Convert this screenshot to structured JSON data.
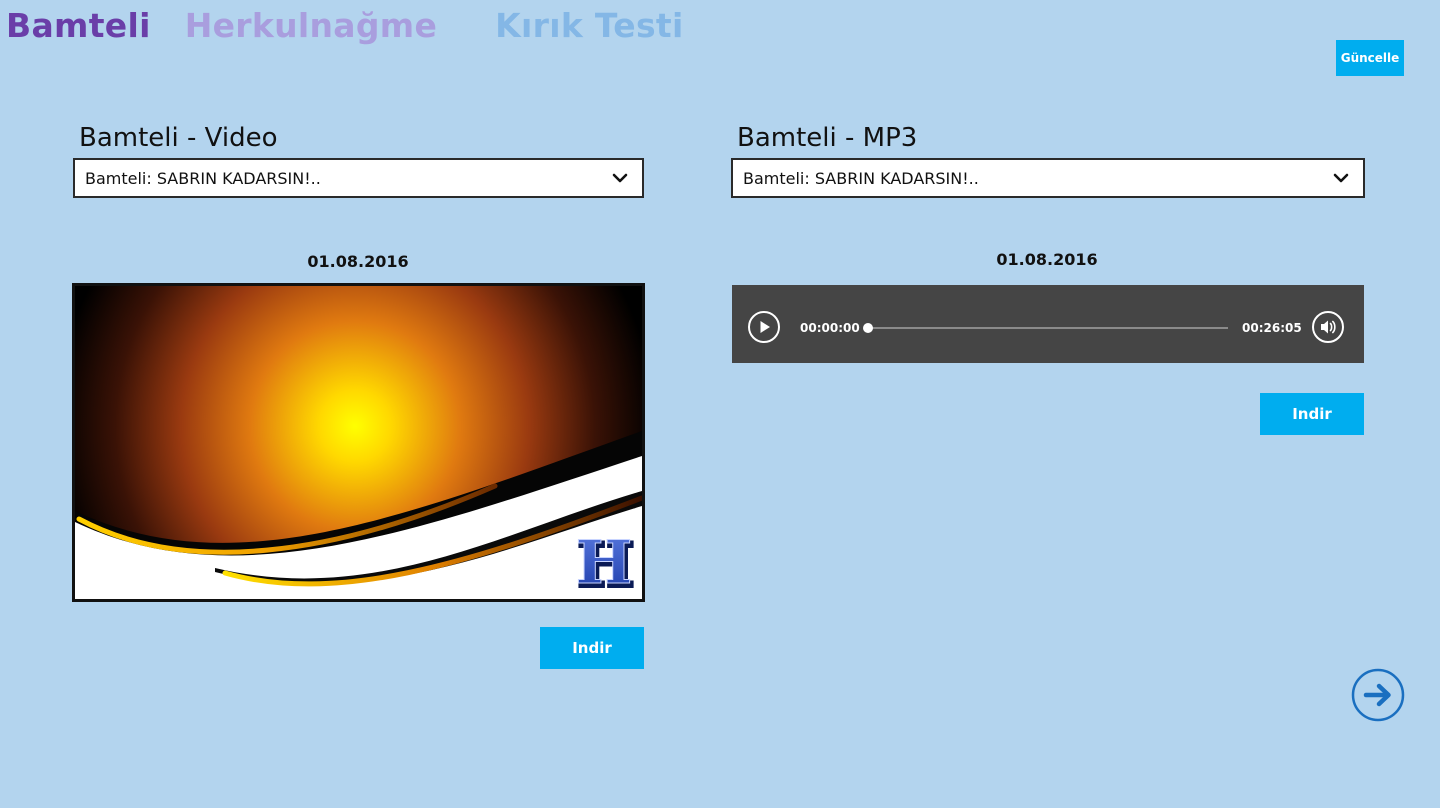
{
  "tabs": [
    {
      "label": "Bamteli"
    },
    {
      "label": "Herkulnağme"
    },
    {
      "label": "Kırık Testi"
    }
  ],
  "header": {
    "update_label": "Güncelle"
  },
  "video_panel": {
    "title": "Bamteli - Video",
    "selected": "Bamteli: SABRIN KADARSIN!..",
    "date": "01.08.2016",
    "download_label": "Indir"
  },
  "audio_panel": {
    "title": "Bamteli - MP3",
    "selected": "Bamteli: SABRIN KADARSIN!..",
    "date": "01.08.2016",
    "download_label": "Indir",
    "player": {
      "current_time": "00:00:00",
      "total_time": "00:26:05",
      "progress": 0
    }
  },
  "colors": {
    "background": "#b3d4ee",
    "accent": "#00adef",
    "tab_active": "#6a3ea8",
    "tab_inactive_1": "#a99ede",
    "tab_inactive_2": "#84b7e6",
    "player_bg": "#454545",
    "next_button": "#1a6fc0"
  },
  "icons": {
    "dropdown": "chevron-down-icon",
    "play": "play-icon",
    "volume": "volume-icon",
    "next": "arrow-right-circle-icon"
  }
}
